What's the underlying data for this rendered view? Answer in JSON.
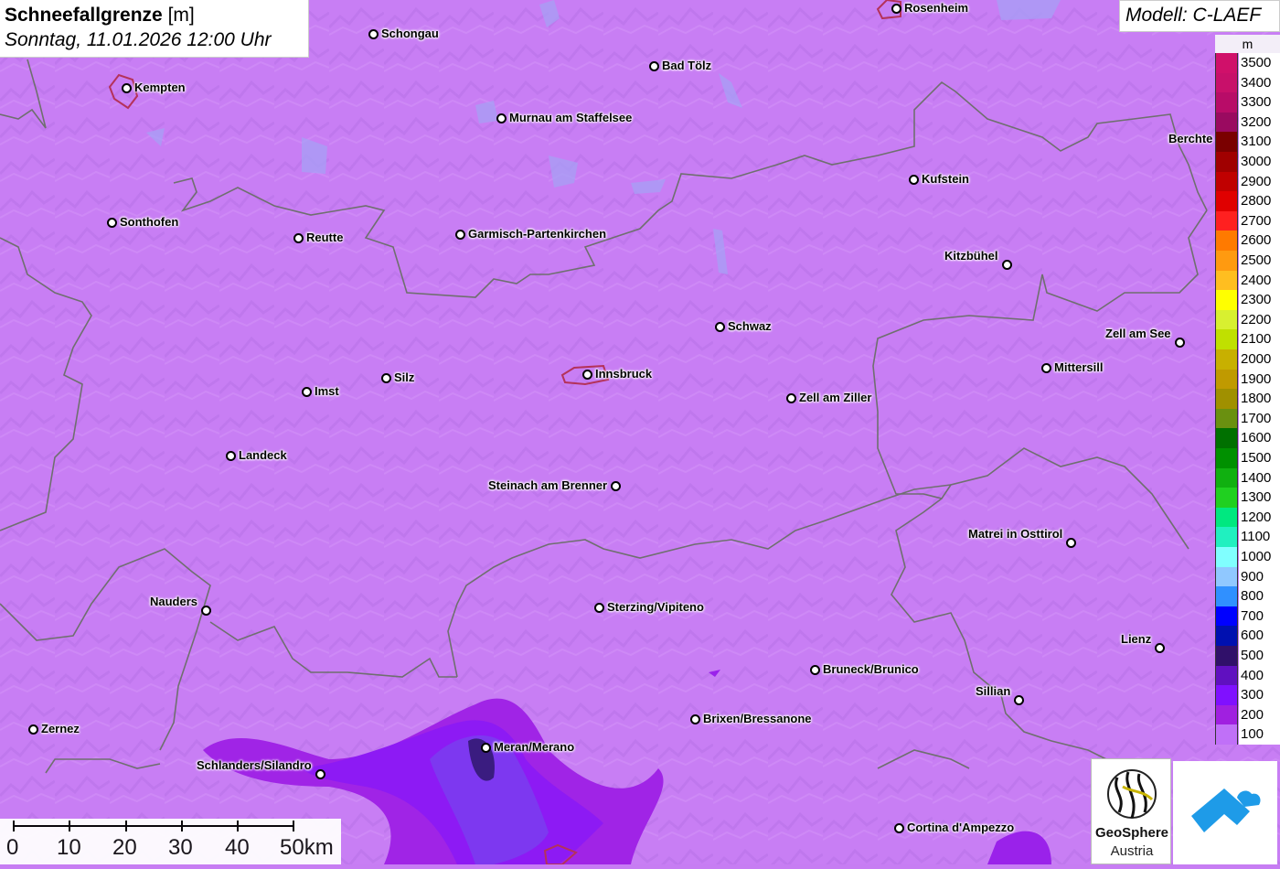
{
  "header": {
    "title_bold": "Schneefallgrenze",
    "title_unit": "[m]",
    "datetime": "Sonntag, 11.01.2026 12:00 Uhr"
  },
  "model": {
    "label": "Modell: C-LAEF"
  },
  "legend": {
    "unit": "m",
    "items": [
      {
        "label": "3500",
        "color": "#d0106a"
      },
      {
        "label": "3400",
        "color": "#c8106a"
      },
      {
        "label": "3300",
        "color": "#b80c68"
      },
      {
        "label": "3200",
        "color": "#9a0a60"
      },
      {
        "label": "3100",
        "color": "#7a0000"
      },
      {
        "label": "3000",
        "color": "#a00000"
      },
      {
        "label": "2900",
        "color": "#c00000"
      },
      {
        "label": "2800",
        "color": "#e00000"
      },
      {
        "label": "2700",
        "color": "#ff2020"
      },
      {
        "label": "2600",
        "color": "#ff7a00"
      },
      {
        "label": "2500",
        "color": "#ff9a10"
      },
      {
        "label": "2400",
        "color": "#ffbe20"
      },
      {
        "label": "2300",
        "color": "#ffff00"
      },
      {
        "label": "2200",
        "color": "#d8f030"
      },
      {
        "label": "2100",
        "color": "#c0e000"
      },
      {
        "label": "2000",
        "color": "#c8b000"
      },
      {
        "label": "1900",
        "color": "#c09a00"
      },
      {
        "label": "1800",
        "color": "#a09000"
      },
      {
        "label": "1700",
        "color": "#6a9010"
      },
      {
        "label": "1600",
        "color": "#007000"
      },
      {
        "label": "1500",
        "color": "#009000"
      },
      {
        "label": "1400",
        "color": "#10b010"
      },
      {
        "label": "1300",
        "color": "#20d020"
      },
      {
        "label": "1200",
        "color": "#00e880"
      },
      {
        "label": "1100",
        "color": "#20f0c0"
      },
      {
        "label": "1000",
        "color": "#80ffff"
      },
      {
        "label": "900",
        "color": "#90c8ff"
      },
      {
        "label": "800",
        "color": "#3090ff"
      },
      {
        "label": "700",
        "color": "#0000ff"
      },
      {
        "label": "600",
        "color": "#0010b0"
      },
      {
        "label": "500",
        "color": "#30106a"
      },
      {
        "label": "400",
        "color": "#6010c0"
      },
      {
        "label": "300",
        "color": "#8010ff"
      },
      {
        "label": "200",
        "color": "#a020e0"
      },
      {
        "label": "100",
        "color": "#c070f8"
      }
    ]
  },
  "cities": [
    {
      "name": "Rosenheim"
    },
    {
      "name": "Schongau"
    },
    {
      "name": "Bad Tölz"
    },
    {
      "name": "Kempten"
    },
    {
      "name": "Murnau am Staffelsee"
    },
    {
      "name": "Berchte"
    },
    {
      "name": "Kufstein"
    },
    {
      "name": "Sonthofen"
    },
    {
      "name": "Reutte"
    },
    {
      "name": "Garmisch-Partenkirchen"
    },
    {
      "name": "Kitzbühel"
    },
    {
      "name": "Schwaz"
    },
    {
      "name": "Zell am See"
    },
    {
      "name": "Mittersill"
    },
    {
      "name": "Silz"
    },
    {
      "name": "Innsbruck"
    },
    {
      "name": "Imst"
    },
    {
      "name": "Zell am Ziller"
    },
    {
      "name": "Landeck"
    },
    {
      "name": "Steinach am Brenner"
    },
    {
      "name": "Matrei in Osttirol"
    },
    {
      "name": "Nauders"
    },
    {
      "name": "Sterzing/Vipiteno"
    },
    {
      "name": "Lienz"
    },
    {
      "name": "Bruneck/Brunico"
    },
    {
      "name": "Sillian"
    },
    {
      "name": "Brixen/Bressanone"
    },
    {
      "name": "Zernez"
    },
    {
      "name": "Meran/Merano"
    },
    {
      "name": "Schlanders/Silandro"
    },
    {
      "name": "Cortina d'Ampezzo"
    }
  ],
  "scalebar": {
    "labels": [
      "0",
      "10",
      "20",
      "30",
      "40",
      "50km"
    ]
  },
  "logos": {
    "geosphere_name": "GeoSphere",
    "geosphere_sub": "Austria"
  }
}
